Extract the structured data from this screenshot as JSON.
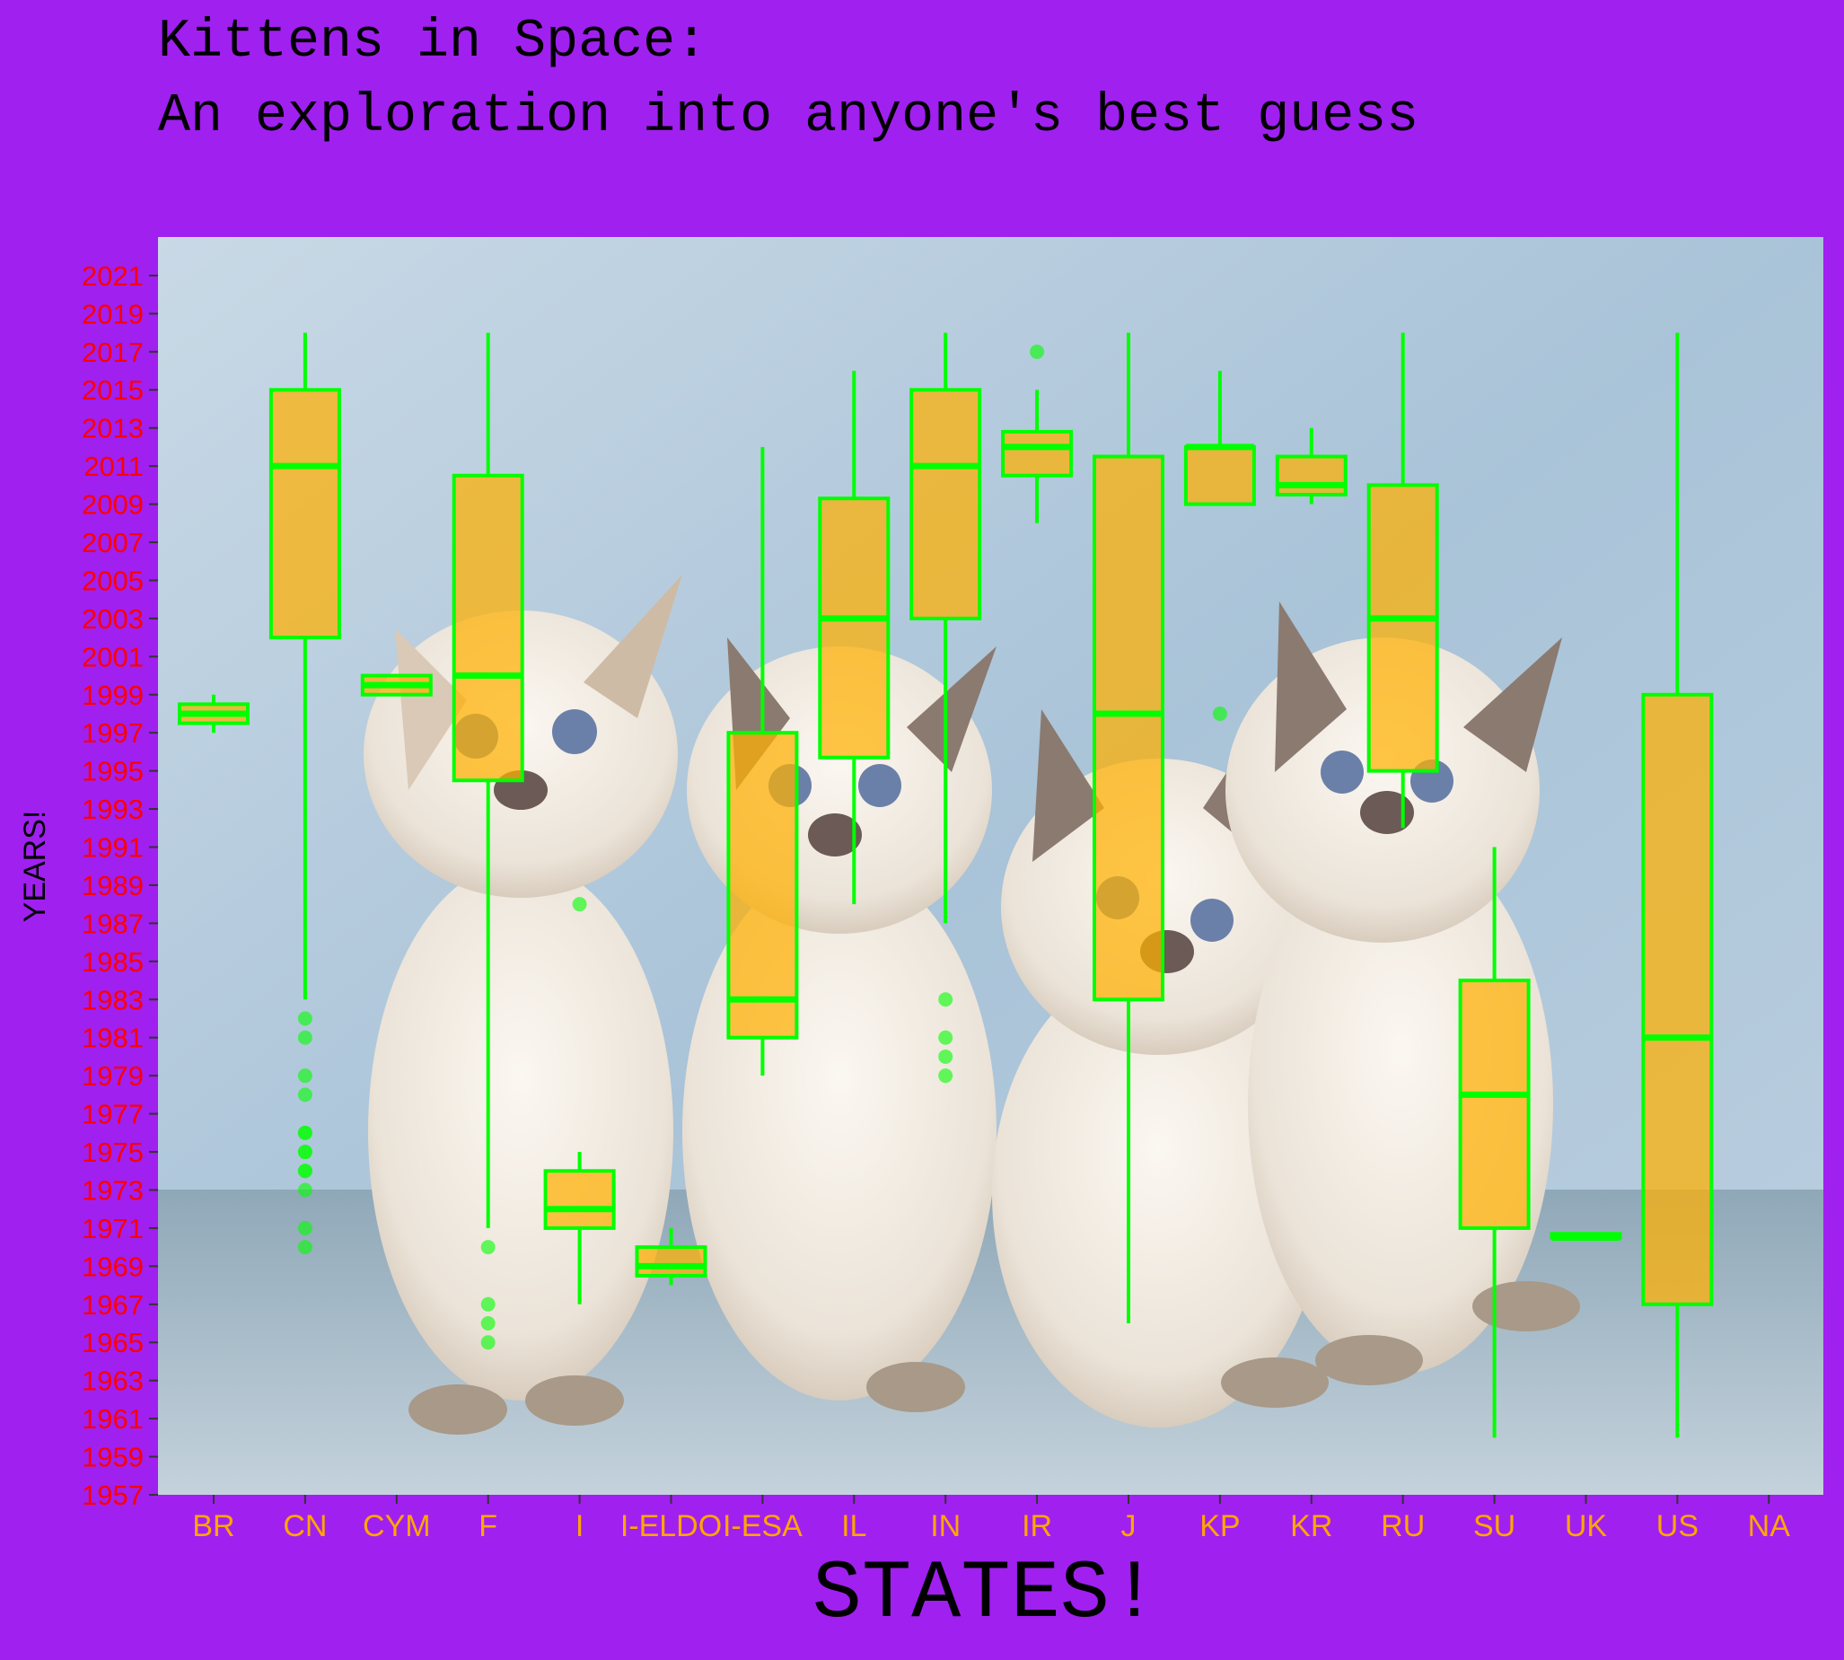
{
  "colors": {
    "background": "#a020f0",
    "box_fill": "#ffb000",
    "box_stroke": "#00ff00",
    "ytick_color": "#ff0000",
    "xtick_color": "#ffa500",
    "text_color": "#000000"
  },
  "panel_background": "photo of kittens on light blue backdrop",
  "chart_data": {
    "type": "box",
    "title": "Kittens in Space:",
    "subtitle": "An exploration into anyone's best guess",
    "xlabel": "STATES!",
    "ylabel": "YEARS!",
    "ylim": [
      1957,
      2023
    ],
    "yticks": [
      1957,
      1959,
      1961,
      1963,
      1965,
      1967,
      1969,
      1971,
      1973,
      1975,
      1977,
      1979,
      1981,
      1983,
      1985,
      1987,
      1989,
      1991,
      1993,
      1995,
      1997,
      1999,
      2001,
      2003,
      2005,
      2007,
      2009,
      2011,
      2013,
      2015,
      2017,
      2019,
      2021
    ],
    "categories": [
      "BR",
      "CN",
      "CYM",
      "F",
      "I",
      "I-ELDO",
      "I-ESA",
      "IL",
      "IN",
      "IR",
      "J",
      "KP",
      "KR",
      "RU",
      "SU",
      "UK",
      "US",
      "NA"
    ],
    "boxes": [
      {
        "cat": "BR",
        "wlo": 1997,
        "q1": 1997.5,
        "med": 1998,
        "q3": 1998.5,
        "whi": 1999,
        "out": []
      },
      {
        "cat": "CN",
        "wlo": 1983,
        "q1": 2002,
        "med": 2011,
        "q3": 2015,
        "whi": 2018,
        "out": [
          1970,
          1971,
          1973,
          1974,
          1974,
          1975,
          1975,
          1976,
          1976,
          1978,
          1979,
          1981,
          1982
        ]
      },
      {
        "cat": "CYM",
        "wlo": 1999,
        "q1": 1999,
        "med": 1999.5,
        "q3": 2000,
        "whi": 2000,
        "out": []
      },
      {
        "cat": "F",
        "wlo": 1971,
        "q1": 1994.5,
        "med": 2000,
        "q3": 2010.5,
        "whi": 2018,
        "out": [
          1965,
          1966,
          1967,
          1970
        ]
      },
      {
        "cat": "I",
        "wlo": 1967,
        "q1": 1971,
        "med": 1972,
        "q3": 1974,
        "whi": 1975,
        "out": [
          1988
        ]
      },
      {
        "cat": "I-ELDO",
        "wlo": 1968,
        "q1": 1968.5,
        "med": 1969,
        "q3": 1970,
        "whi": 1971,
        "out": []
      },
      {
        "cat": "I-ESA",
        "wlo": 1979,
        "q1": 1981,
        "med": 1983,
        "q3": 1997,
        "whi": 2012,
        "out": []
      },
      {
        "cat": "IL",
        "wlo": 1988,
        "q1": 1995.7,
        "med": 2003,
        "q3": 2009.3,
        "whi": 2016,
        "out": []
      },
      {
        "cat": "IN",
        "wlo": 1987,
        "q1": 2003,
        "med": 2011,
        "q3": 2015,
        "whi": 2018,
        "out": [
          1979,
          1980,
          1981,
          1983
        ]
      },
      {
        "cat": "IR",
        "wlo": 2008,
        "q1": 2010.5,
        "med": 2012,
        "q3": 2012.8,
        "whi": 2015,
        "out": [
          2017
        ]
      },
      {
        "cat": "J",
        "wlo": 1966,
        "q1": 1983,
        "med": 1998,
        "q3": 2011.5,
        "whi": 2018,
        "out": []
      },
      {
        "cat": "KP",
        "wlo": 2009,
        "q1": 2009,
        "med": 2012,
        "q3": 2012,
        "whi": 2016,
        "out": [
          1998
        ]
      },
      {
        "cat": "KR",
        "wlo": 2009,
        "q1": 2009.5,
        "med": 2010,
        "q3": 2011.5,
        "whi": 2013,
        "out": []
      },
      {
        "cat": "RU",
        "wlo": 1992,
        "q1": 1995,
        "med": 2003,
        "q3": 2010,
        "whi": 2018,
        "out": []
      },
      {
        "cat": "SU",
        "wlo": 1960,
        "q1": 1971,
        "med": 1978,
        "q3": 1984,
        "whi": 1991,
        "out": []
      },
      {
        "cat": "UK",
        "wlo": 1970.5,
        "q1": 1970.5,
        "med": 1970.5,
        "q3": 1970.7,
        "whi": 1970.7,
        "out": []
      },
      {
        "cat": "US",
        "wlo": 1960,
        "q1": 1967,
        "med": 1981,
        "q3": 1999,
        "whi": 2018,
        "out": []
      }
    ]
  }
}
